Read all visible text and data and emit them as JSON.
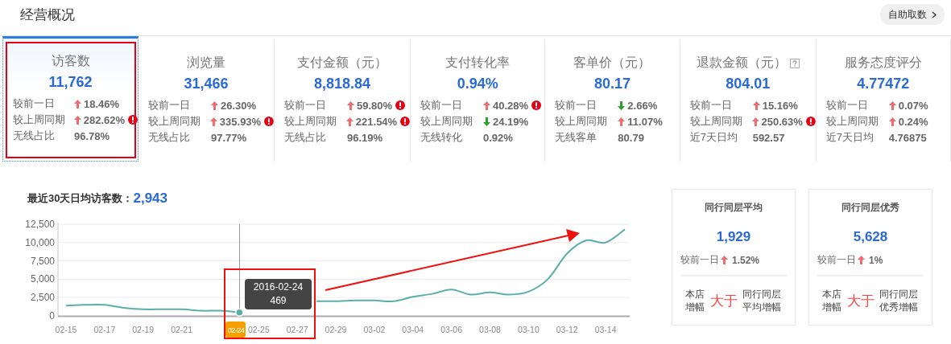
{
  "header": {
    "title": "经营概况",
    "button": "自助取数"
  },
  "metrics": [
    {
      "title": "访客数",
      "value": "11,762",
      "help": false,
      "selected": true,
      "annotated": true,
      "rows": [
        {
          "label": "较前一日",
          "kind": "rise",
          "value": "18.46%",
          "alert": false
        },
        {
          "label": "较上周同期",
          "kind": "rise",
          "value": "282.62%",
          "alert": true
        },
        {
          "label": "无线占比",
          "kind": "plain",
          "value": "96.78%",
          "alert": false
        }
      ]
    },
    {
      "title": "浏览量",
      "value": "31,466",
      "help": false,
      "selected": false,
      "annotated": false,
      "rows": [
        {
          "label": "较前一日",
          "kind": "rise",
          "value": "26.30%",
          "alert": false
        },
        {
          "label": "较上周同期",
          "kind": "rise",
          "value": "335.93%",
          "alert": true
        },
        {
          "label": "无线占比",
          "kind": "plain",
          "value": "97.77%",
          "alert": false
        }
      ]
    },
    {
      "title": "支付金额（元）",
      "value": "8,818.84",
      "help": false,
      "selected": false,
      "annotated": false,
      "rows": [
        {
          "label": "较前一日",
          "kind": "rise",
          "value": "59.80%",
          "alert": true
        },
        {
          "label": "较上周同期",
          "kind": "rise",
          "value": "221.54%",
          "alert": true
        },
        {
          "label": "无线占比",
          "kind": "plain",
          "value": "96.19%",
          "alert": false
        }
      ]
    },
    {
      "title": "支付转化率",
      "value": "0.94%",
      "help": false,
      "selected": false,
      "annotated": false,
      "rows": [
        {
          "label": "较前一日",
          "kind": "rise",
          "value": "40.28%",
          "alert": true
        },
        {
          "label": "较上周同期",
          "kind": "fall",
          "value": "24.19%",
          "alert": false
        },
        {
          "label": "无线转化",
          "kind": "plain",
          "value": "0.92%",
          "alert": false
        }
      ]
    },
    {
      "title": "客单价（元）",
      "value": "80.17",
      "help": false,
      "selected": false,
      "annotated": false,
      "rows": [
        {
          "label": "较前一日",
          "kind": "fall",
          "value": "2.66%",
          "alert": false
        },
        {
          "label": "较上周同期",
          "kind": "rise",
          "value": "11.07%",
          "alert": false
        },
        {
          "label": "无线客单",
          "kind": "plain",
          "value": "80.79",
          "alert": false
        }
      ]
    },
    {
      "title": "退款金额（元）",
      "value": "804.01",
      "help": true,
      "selected": false,
      "annotated": false,
      "rows": [
        {
          "label": "较前一日",
          "kind": "rise",
          "value": "15.16%",
          "alert": false
        },
        {
          "label": "较上周同期",
          "kind": "rise",
          "value": "250.63%",
          "alert": true
        },
        {
          "label": "近7天日均",
          "kind": "plain",
          "value": "592.57",
          "alert": false
        }
      ]
    },
    {
      "title": "服务态度评分",
      "value": "4.77472",
      "help": false,
      "selected": false,
      "annotated": false,
      "rows": [
        {
          "label": "较前一日",
          "kind": "rise",
          "value": "0.07%",
          "alert": false
        },
        {
          "label": "较上周同期",
          "kind": "rise",
          "value": "0.24%",
          "alert": false
        },
        {
          "label": "近7天日均",
          "kind": "plain",
          "value": "4.76875",
          "alert": false
        }
      ]
    }
  ],
  "summary": {
    "label": "最近30天日均访客数：",
    "value": "2,943"
  },
  "chart_data": {
    "type": "line",
    "categories": [
      "02-15",
      null,
      "02-17",
      null,
      "02-19",
      null,
      "02-21",
      null,
      null,
      "02-24",
      "02-25",
      null,
      "02-27",
      null,
      "02-29",
      null,
      "03-02",
      null,
      "03-04",
      null,
      "03-06",
      null,
      "03-08",
      null,
      "03-10",
      null,
      "03-12",
      null,
      "03-14",
      null
    ],
    "series": [
      {
        "color": "#5aafa9",
        "values": [
          1400,
          1500,
          1500,
          1100,
          900,
          900,
          900,
          700,
          700,
          469,
          null,
          null,
          null,
          2000,
          2000,
          2100,
          2100,
          2000,
          2600,
          3000,
          3600,
          2900,
          3200,
          2900,
          3300,
          5000,
          8500,
          10300,
          10000,
          11800
        ]
      }
    ],
    "ylim": [
      0,
      12500
    ],
    "grid": true,
    "yticks": [
      {
        "value": 0,
        "label": "0"
      },
      {
        "value": 2500,
        "label": "2,500"
      },
      {
        "value": 5000,
        "label": "5,000"
      },
      {
        "value": 7500,
        "label": "7,500"
      },
      {
        "value": 10000,
        "label": "10,000"
      },
      {
        "value": 12500,
        "label": "12,500"
      }
    ]
  },
  "tooltip": {
    "date": "2016-02-24",
    "value": "469",
    "boxed": true
  },
  "trend_arrow": true,
  "peers": [
    {
      "title": "同行同层平均",
      "value": "1,929",
      "compare_label": "较前一日",
      "up": true,
      "change": "1.52%",
      "left": "本店增幅",
      "relation": "大于",
      "right": "同行同层平均增幅"
    },
    {
      "title": "同行同层优秀",
      "value": "5,628",
      "compare_label": "较前一日",
      "up": true,
      "change": "1%",
      "left": "本店增幅",
      "relation": "大于",
      "right": "同行同层优秀增幅"
    }
  ]
}
